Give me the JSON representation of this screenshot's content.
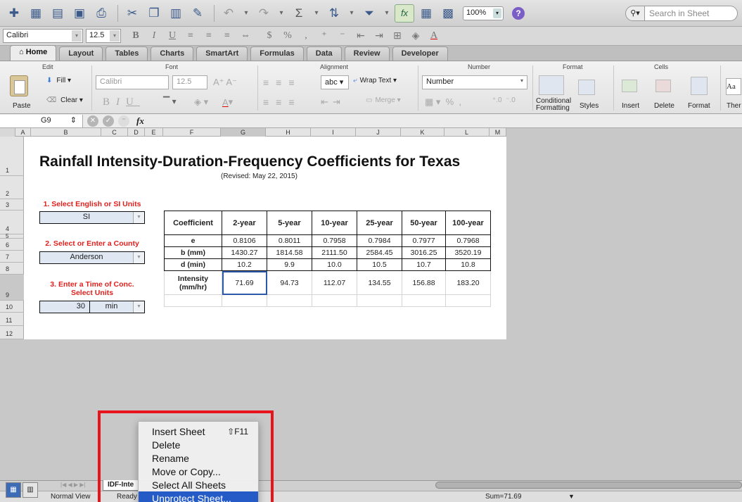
{
  "toolbar": {
    "zoom": "100%",
    "search_placeholder": "Search in Sheet"
  },
  "fontbar": {
    "font": "Calibri",
    "size": "12.5"
  },
  "tabs": [
    "Home",
    "Layout",
    "Tables",
    "Charts",
    "SmartArt",
    "Formulas",
    "Data",
    "Review",
    "Developer"
  ],
  "ribbon": {
    "groups": {
      "edit": "Edit",
      "font": "Font",
      "alignment": "Alignment",
      "number": "Number",
      "format": "Format",
      "cells": "Cells"
    },
    "paste": "Paste",
    "fill": "Fill",
    "clear": "Clear",
    "font": "Calibri",
    "size": "12.5",
    "abc": "abc",
    "wrap": "Wrap Text",
    "merge": "Merge",
    "number_format": "Number",
    "conditional": "Conditional",
    "formatting": "Formatting",
    "styles": "Styles",
    "insert": "Insert",
    "delete": "Delete",
    "format": "Format",
    "themes": "Ther",
    "aa": "Aa"
  },
  "formula_bar": {
    "cell_ref": "G9",
    "fx": "fx"
  },
  "columns": [
    "A",
    "B",
    "C",
    "D",
    "E",
    "F",
    "G",
    "H",
    "I",
    "J",
    "K",
    "L",
    "M"
  ],
  "rows": [
    "1",
    "2",
    "3",
    "4",
    "5",
    "6",
    "7",
    "8",
    "9",
    "10",
    "11",
    "12"
  ],
  "sheet": {
    "title": "Rainfall Intensity-Duration-Frequency Coefficients for Texas",
    "subtitle": "(Revised: May 22, 2015)",
    "step1": "1. Select English or SI Units",
    "units": "SI",
    "step2": "2. Select or Enter a County",
    "county": "Anderson",
    "step3_line1": "3. Enter a Time of Conc.",
    "step3_line2": "Select Units",
    "time": "30",
    "time_unit": "min"
  },
  "table": {
    "header": [
      "Coefficient",
      "2-year",
      "5-year",
      "10-year",
      "25-year",
      "50-year",
      "100-year"
    ],
    "rows": [
      [
        "e",
        "0.8106",
        "0.8011",
        "0.7958",
        "0.7984",
        "0.7977",
        "0.7968"
      ],
      [
        "b (mm)",
        "1430.27",
        "1814.58",
        "2111.50",
        "2584.45",
        "3016.25",
        "3520.19"
      ],
      [
        "d (min)",
        "10.2",
        "9.9",
        "10.0",
        "10.5",
        "10.7",
        "10.8"
      ]
    ],
    "intensity_label_1": "Intensity",
    "intensity_label_2": "(mm/hr)",
    "intensity": [
      "71.69",
      "94.73",
      "112.07",
      "134.55",
      "156.88",
      "183.20"
    ]
  },
  "context_menu": {
    "items": [
      "Insert Sheet",
      "Delete",
      "Rename",
      "Move or Copy...",
      "Select All Sheets",
      "Unprotect Sheet..."
    ],
    "shortcut": "⇧F11"
  },
  "status": {
    "sheet_tab": "IDF-Inte",
    "view": "Normal View",
    "ready": "Ready",
    "sum": "Sum=71.69"
  }
}
